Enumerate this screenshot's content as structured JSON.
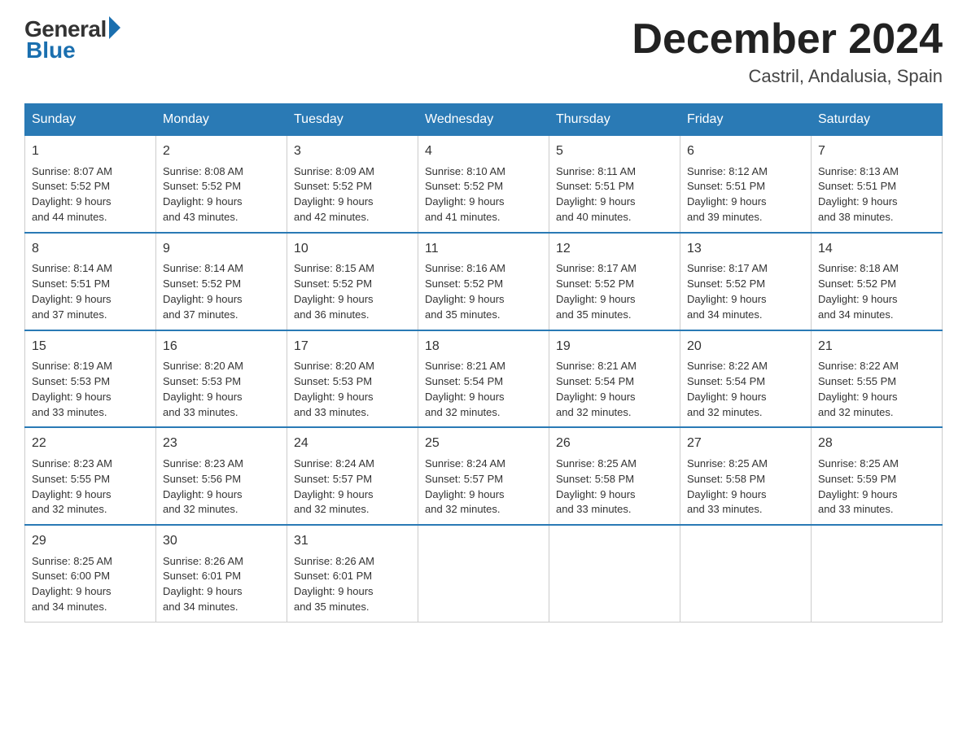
{
  "logo": {
    "general": "General",
    "blue": "Blue"
  },
  "title": "December 2024",
  "location": "Castril, Andalusia, Spain",
  "days_of_week": [
    "Sunday",
    "Monday",
    "Tuesday",
    "Wednesday",
    "Thursday",
    "Friday",
    "Saturday"
  ],
  "weeks": [
    [
      {
        "day": "1",
        "sunrise": "8:07 AM",
        "sunset": "5:52 PM",
        "daylight": "9 hours and 44 minutes."
      },
      {
        "day": "2",
        "sunrise": "8:08 AM",
        "sunset": "5:52 PM",
        "daylight": "9 hours and 43 minutes."
      },
      {
        "day": "3",
        "sunrise": "8:09 AM",
        "sunset": "5:52 PM",
        "daylight": "9 hours and 42 minutes."
      },
      {
        "day": "4",
        "sunrise": "8:10 AM",
        "sunset": "5:52 PM",
        "daylight": "9 hours and 41 minutes."
      },
      {
        "day": "5",
        "sunrise": "8:11 AM",
        "sunset": "5:51 PM",
        "daylight": "9 hours and 40 minutes."
      },
      {
        "day": "6",
        "sunrise": "8:12 AM",
        "sunset": "5:51 PM",
        "daylight": "9 hours and 39 minutes."
      },
      {
        "day": "7",
        "sunrise": "8:13 AM",
        "sunset": "5:51 PM",
        "daylight": "9 hours and 38 minutes."
      }
    ],
    [
      {
        "day": "8",
        "sunrise": "8:14 AM",
        "sunset": "5:51 PM",
        "daylight": "9 hours and 37 minutes."
      },
      {
        "day": "9",
        "sunrise": "8:14 AM",
        "sunset": "5:52 PM",
        "daylight": "9 hours and 37 minutes."
      },
      {
        "day": "10",
        "sunrise": "8:15 AM",
        "sunset": "5:52 PM",
        "daylight": "9 hours and 36 minutes."
      },
      {
        "day": "11",
        "sunrise": "8:16 AM",
        "sunset": "5:52 PM",
        "daylight": "9 hours and 35 minutes."
      },
      {
        "day": "12",
        "sunrise": "8:17 AM",
        "sunset": "5:52 PM",
        "daylight": "9 hours and 35 minutes."
      },
      {
        "day": "13",
        "sunrise": "8:17 AM",
        "sunset": "5:52 PM",
        "daylight": "9 hours and 34 minutes."
      },
      {
        "day": "14",
        "sunrise": "8:18 AM",
        "sunset": "5:52 PM",
        "daylight": "9 hours and 34 minutes."
      }
    ],
    [
      {
        "day": "15",
        "sunrise": "8:19 AM",
        "sunset": "5:53 PM",
        "daylight": "9 hours and 33 minutes."
      },
      {
        "day": "16",
        "sunrise": "8:20 AM",
        "sunset": "5:53 PM",
        "daylight": "9 hours and 33 minutes."
      },
      {
        "day": "17",
        "sunrise": "8:20 AM",
        "sunset": "5:53 PM",
        "daylight": "9 hours and 33 minutes."
      },
      {
        "day": "18",
        "sunrise": "8:21 AM",
        "sunset": "5:54 PM",
        "daylight": "9 hours and 32 minutes."
      },
      {
        "day": "19",
        "sunrise": "8:21 AM",
        "sunset": "5:54 PM",
        "daylight": "9 hours and 32 minutes."
      },
      {
        "day": "20",
        "sunrise": "8:22 AM",
        "sunset": "5:54 PM",
        "daylight": "9 hours and 32 minutes."
      },
      {
        "day": "21",
        "sunrise": "8:22 AM",
        "sunset": "5:55 PM",
        "daylight": "9 hours and 32 minutes."
      }
    ],
    [
      {
        "day": "22",
        "sunrise": "8:23 AM",
        "sunset": "5:55 PM",
        "daylight": "9 hours and 32 minutes."
      },
      {
        "day": "23",
        "sunrise": "8:23 AM",
        "sunset": "5:56 PM",
        "daylight": "9 hours and 32 minutes."
      },
      {
        "day": "24",
        "sunrise": "8:24 AM",
        "sunset": "5:57 PM",
        "daylight": "9 hours and 32 minutes."
      },
      {
        "day": "25",
        "sunrise": "8:24 AM",
        "sunset": "5:57 PM",
        "daylight": "9 hours and 32 minutes."
      },
      {
        "day": "26",
        "sunrise": "8:25 AM",
        "sunset": "5:58 PM",
        "daylight": "9 hours and 33 minutes."
      },
      {
        "day": "27",
        "sunrise": "8:25 AM",
        "sunset": "5:58 PM",
        "daylight": "9 hours and 33 minutes."
      },
      {
        "day": "28",
        "sunrise": "8:25 AM",
        "sunset": "5:59 PM",
        "daylight": "9 hours and 33 minutes."
      }
    ],
    [
      {
        "day": "29",
        "sunrise": "8:25 AM",
        "sunset": "6:00 PM",
        "daylight": "9 hours and 34 minutes."
      },
      {
        "day": "30",
        "sunrise": "8:26 AM",
        "sunset": "6:01 PM",
        "daylight": "9 hours and 34 minutes."
      },
      {
        "day": "31",
        "sunrise": "8:26 AM",
        "sunset": "6:01 PM",
        "daylight": "9 hours and 35 minutes."
      },
      null,
      null,
      null,
      null
    ]
  ],
  "labels": {
    "sunrise": "Sunrise:",
    "sunset": "Sunset:",
    "daylight": "Daylight:"
  }
}
